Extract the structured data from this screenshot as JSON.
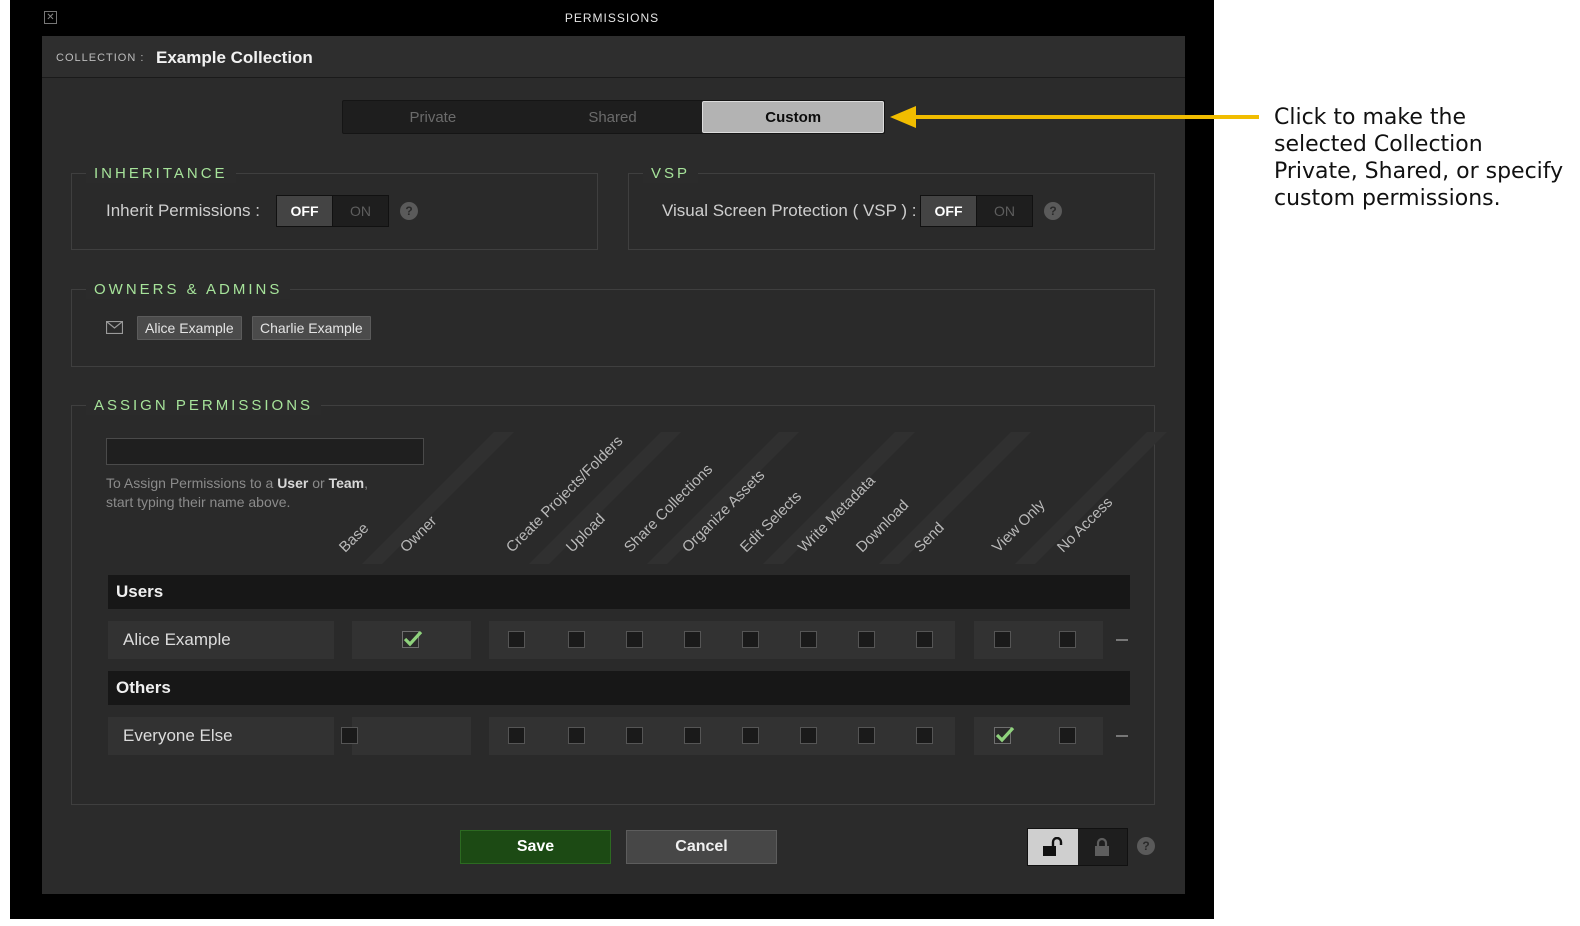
{
  "window": {
    "title": "PERMISSIONS"
  },
  "collection": {
    "label": "COLLECTION :",
    "name": "Example Collection"
  },
  "mode_tabs": [
    {
      "label": "Private",
      "active": false
    },
    {
      "label": "Shared",
      "active": false
    },
    {
      "label": "Custom",
      "active": true
    }
  ],
  "inheritance": {
    "title": "INHERITANCE",
    "label": "Inherit Permissions :",
    "off": "OFF",
    "on": "ON",
    "state": "OFF",
    "help": "?"
  },
  "vsp": {
    "title": "VSP",
    "label": "Visual Screen Protection ( VSP ) :",
    "off": "OFF",
    "on": "ON",
    "state": "OFF",
    "help": "?"
  },
  "owners": {
    "title": "OWNERS & ADMINS",
    "names": [
      "Alice Example",
      "Charlie Example"
    ]
  },
  "assign": {
    "title": "ASSIGN PERMISSIONS",
    "search_value": "",
    "hint_prefix": "To Assign Permissions to a ",
    "hint_user": "User",
    "hint_or": " or ",
    "hint_team": "Team",
    "hint_suffix": ",",
    "hint_line2": "start typing their name above.",
    "columns": [
      "Base",
      "Owner",
      "Create Projects/Folders",
      "Upload",
      "Share Collections",
      "Organize Assets",
      "Edit Selects",
      "Write Metadata",
      "Download",
      "Send",
      "View Only",
      "No Access"
    ],
    "sections": [
      {
        "title": "Users",
        "rows": [
          {
            "name": "Alice Example",
            "checks": [
              null,
              true,
              false,
              false,
              false,
              false,
              false,
              false,
              false,
              false,
              false,
              false
            ]
          }
        ]
      },
      {
        "title": "Others",
        "rows": [
          {
            "name": "Everyone Else",
            "checks": [
              false,
              null,
              false,
              false,
              false,
              false,
              false,
              false,
              false,
              false,
              true,
              false
            ]
          }
        ]
      }
    ]
  },
  "footer": {
    "save": "Save",
    "cancel": "Cancel",
    "lock_state": "unlocked",
    "help": "?"
  },
  "colors": {
    "accent_green": "#a6e39a",
    "save_green": "#1c4a14",
    "annotation_arrow": "#f1bd00",
    "check_green": "#8fd27d"
  },
  "annotation": {
    "text": "Click to make the selected Collection Private, Shared, or specify custom permissions."
  }
}
